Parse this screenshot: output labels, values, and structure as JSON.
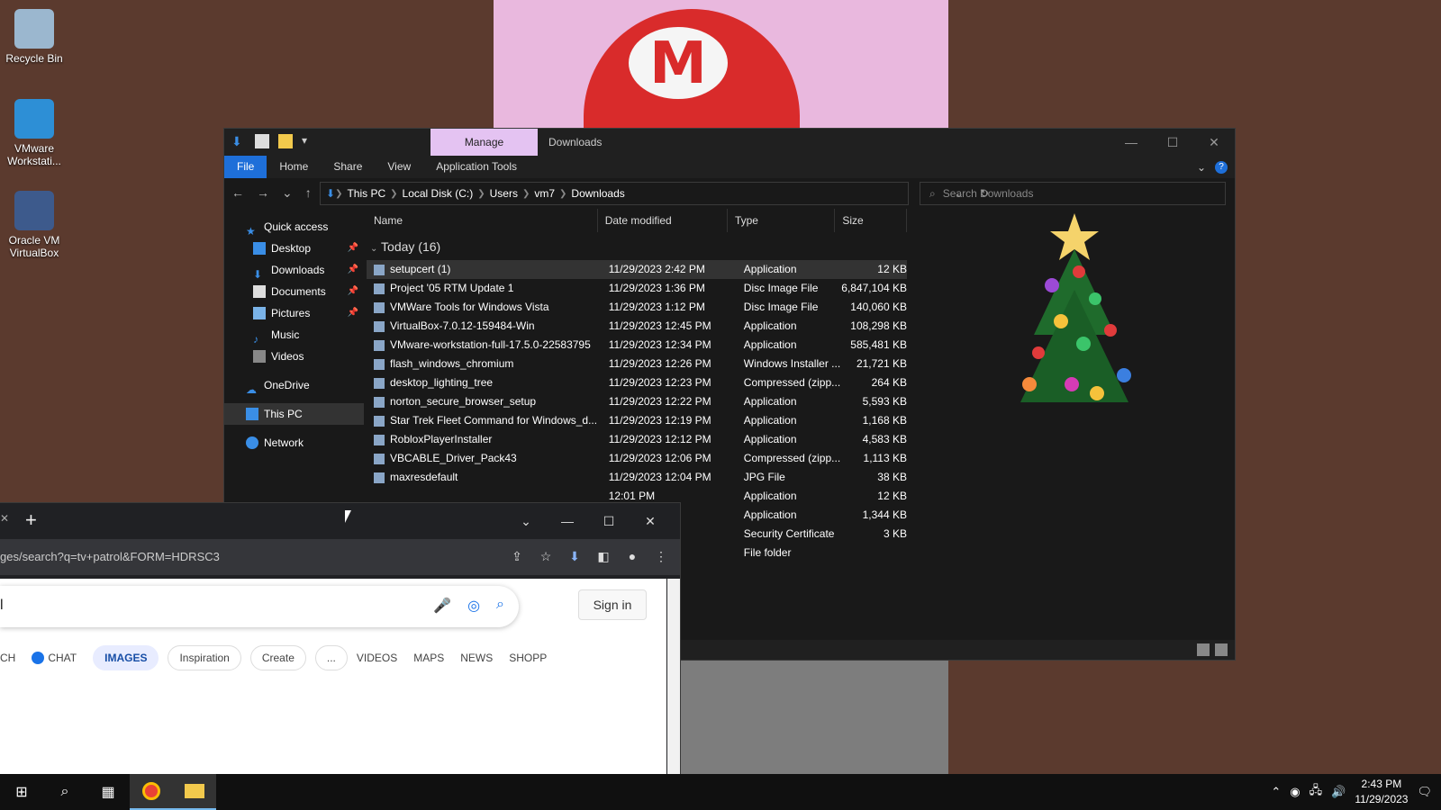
{
  "desktop": {
    "icons": [
      {
        "label": "Recycle Bin",
        "icon": "recycle-bin-icon"
      },
      {
        "label": "VMware Workstati...",
        "icon": "vmware-icon"
      },
      {
        "label": "Oracle VM VirtualBox",
        "icon": "virtualbox-icon"
      }
    ]
  },
  "explorer": {
    "manage_tab": "Manage",
    "title": "Downloads",
    "ribbon_tabs": [
      "File",
      "Home",
      "Share",
      "View",
      "Application Tools"
    ],
    "breadcrumb": [
      "This PC",
      "Local Disk (C:)",
      "Users",
      "vm7",
      "Downloads"
    ],
    "search_placeholder": "Search Downloads",
    "nav": {
      "quick_access": "Quick access",
      "items": [
        "Desktop",
        "Downloads",
        "Documents",
        "Pictures",
        "Music",
        "Videos"
      ],
      "onedrive": "OneDrive",
      "this_pc": "This PC",
      "network": "Network"
    },
    "columns": {
      "name": "Name",
      "date": "Date modified",
      "type": "Type",
      "size": "Size"
    },
    "group": "Today (16)",
    "rows": [
      {
        "name": "setupcert (1)",
        "date": "11/29/2023 2:42 PM",
        "type": "Application",
        "size": "12 KB"
      },
      {
        "name": "Project '05 RTM Update 1",
        "date": "11/29/2023 1:36 PM",
        "type": "Disc Image File",
        "size": "6,847,104 KB"
      },
      {
        "name": "VMWare Tools for Windows Vista",
        "date": "11/29/2023 1:12 PM",
        "type": "Disc Image File",
        "size": "140,060 KB"
      },
      {
        "name": "VirtualBox-7.0.12-159484-Win",
        "date": "11/29/2023 12:45 PM",
        "type": "Application",
        "size": "108,298 KB"
      },
      {
        "name": "VMware-workstation-full-17.5.0-22583795",
        "date": "11/29/2023 12:34 PM",
        "type": "Application",
        "size": "585,481 KB"
      },
      {
        "name": "flash_windows_chromium",
        "date": "11/29/2023 12:26 PM",
        "type": "Windows Installer ...",
        "size": "21,721 KB"
      },
      {
        "name": "desktop_lighting_tree",
        "date": "11/29/2023 12:23 PM",
        "type": "Compressed (zipp...",
        "size": "264 KB"
      },
      {
        "name": "norton_secure_browser_setup",
        "date": "11/29/2023 12:22 PM",
        "type": "Application",
        "size": "5,593 KB"
      },
      {
        "name": "Star Trek Fleet Command for Windows_d...",
        "date": "11/29/2023 12:19 PM",
        "type": "Application",
        "size": "1,168 KB"
      },
      {
        "name": "RobloxPlayerInstaller",
        "date": "11/29/2023 12:12 PM",
        "type": "Application",
        "size": "4,583 KB"
      },
      {
        "name": "VBCABLE_Driver_Pack43",
        "date": "11/29/2023 12:06 PM",
        "type": "Compressed (zipp...",
        "size": "1,113 KB"
      },
      {
        "name": "maxresdefault",
        "date": "11/29/2023 12:04 PM",
        "type": "JPG File",
        "size": "38 KB"
      },
      {
        "name": "",
        "date": "12:01 PM",
        "type": "Application",
        "size": "12 KB"
      },
      {
        "name": "",
        "date": "2:00 PM",
        "type": "Application",
        "size": "1,344 KB"
      },
      {
        "name": "",
        "date": "1:58 AM",
        "type": "Security Certificate",
        "size": "3 KB"
      },
      {
        "name": "",
        "date": "2:06 PM",
        "type": "File folder",
        "size": ""
      }
    ]
  },
  "browser": {
    "url": "ges/search?q=tv+patrol&FORM=HDRSC3",
    "search_value": "l",
    "signin": "Sign in",
    "scopes": [
      "CH",
      "CHAT",
      "IMAGES",
      "Inspiration",
      "Create",
      "...",
      "VIDEOS",
      "MAPS",
      "NEWS",
      "SHOPP"
    ]
  },
  "taskbar": {
    "time": "2:43 PM",
    "date": "11/29/2023"
  }
}
